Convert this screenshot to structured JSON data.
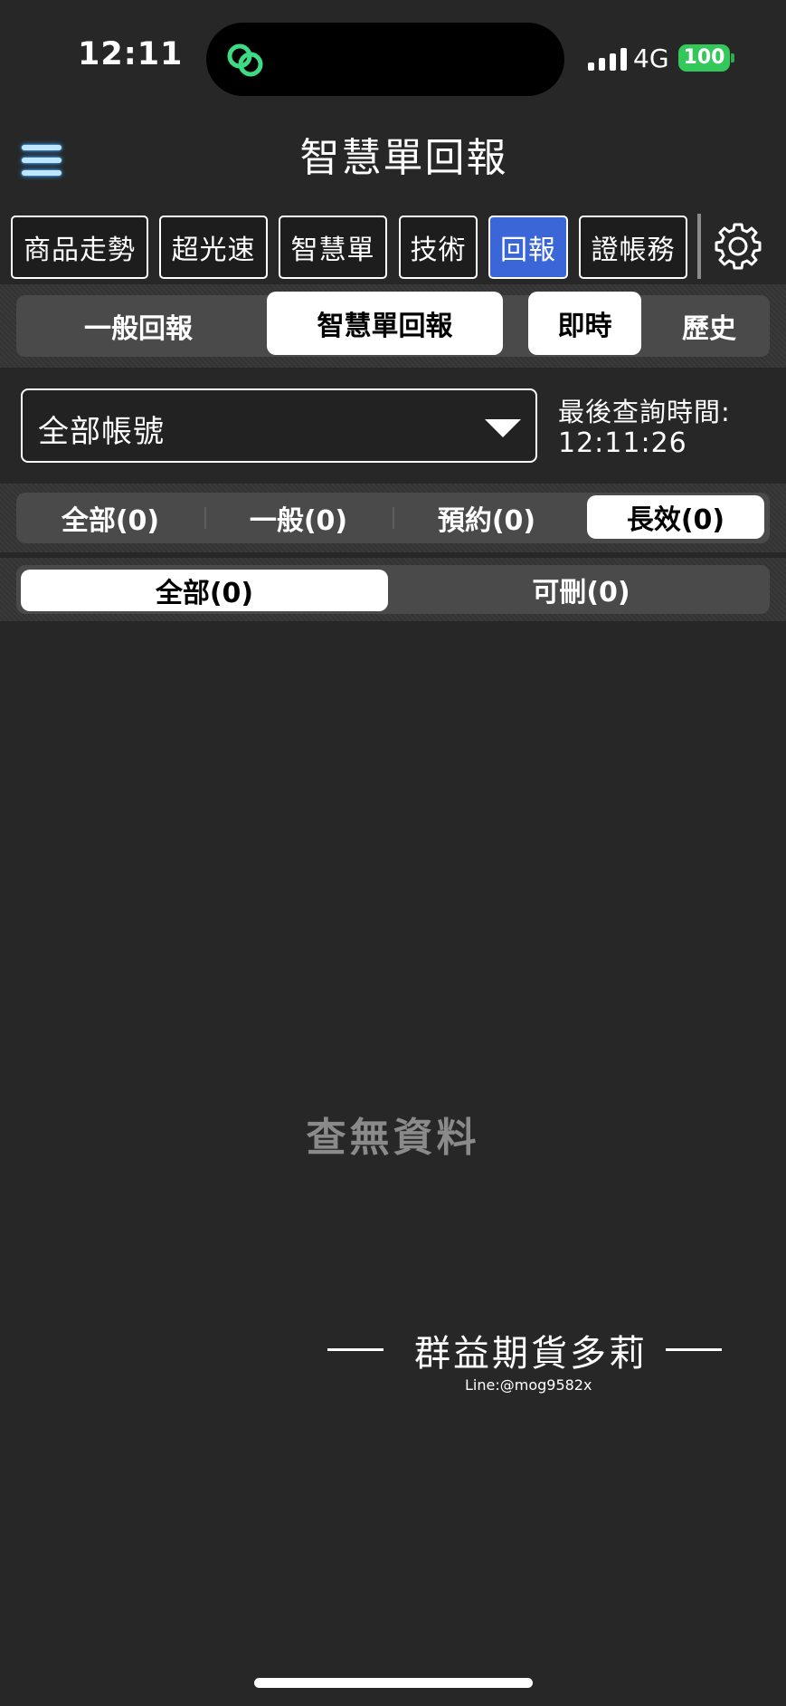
{
  "status_bar": {
    "time": "12:11",
    "network": "4G",
    "battery": "100"
  },
  "header": {
    "title": "智慧單回報"
  },
  "main_tabs": [
    {
      "label": "商品走勢",
      "active": false
    },
    {
      "label": "超光速",
      "active": false
    },
    {
      "label": "智慧單",
      "active": false
    },
    {
      "label": "技術",
      "active": false
    },
    {
      "label": "回報",
      "active": true
    },
    {
      "label": "證帳務",
      "active": false
    }
  ],
  "report_type": {
    "options": [
      "一般回報",
      "智慧單回報"
    ],
    "selected": "智慧單回報"
  },
  "time_mode": {
    "options": [
      "即時",
      "歷史"
    ],
    "selected": "即時"
  },
  "account": {
    "value": "全部帳號",
    "last_query_label": "最後查詢時間:",
    "last_query_time": "12:11:26"
  },
  "order_filter": {
    "options": [
      "全部(0)",
      "一般(0)",
      "預約(0)",
      "長效(0)"
    ],
    "selected": "長效(0)"
  },
  "sub_filter": {
    "options": [
      "全部(0)",
      "可刪(0)"
    ],
    "selected": "全部(0)"
  },
  "empty_state": "查無資料",
  "watermark": {
    "name": "群益期貨多莉",
    "line_id": "Line:@mog9582x"
  },
  "colors": {
    "background": "#272727",
    "active_tab": "#3a66d8",
    "battery": "#34c759",
    "icon_green": "#3ddc84"
  }
}
